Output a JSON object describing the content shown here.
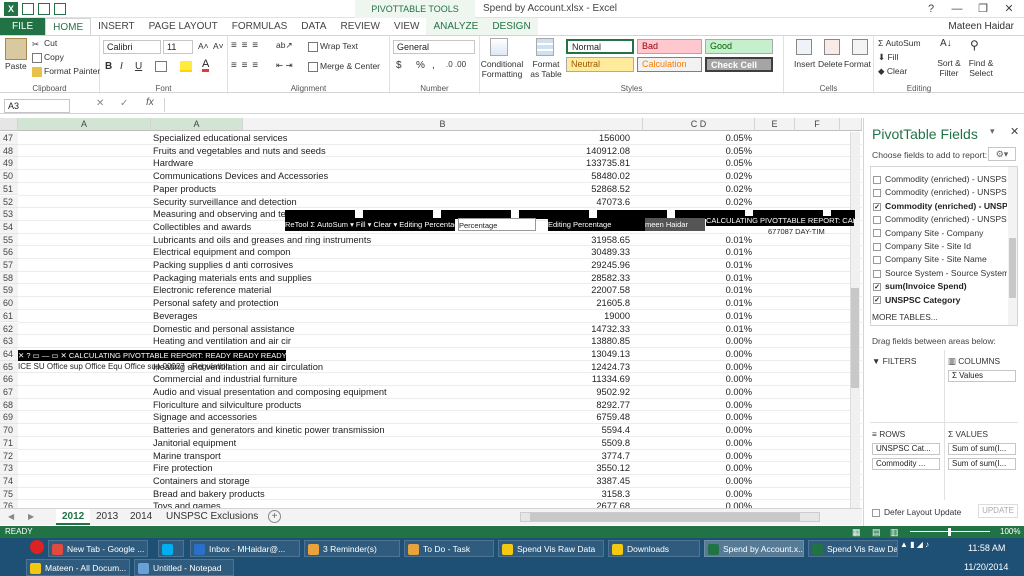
{
  "title_bar": {
    "context_tool": "PIVOTTABLE TOOLS",
    "document_title": "Spend by Account.xlsx - Excel",
    "help": "?",
    "minimize": "—",
    "restore": "❐",
    "close": "✕"
  },
  "tabs": [
    "FILE",
    "HOME",
    "INSERT",
    "PAGE LAYOUT",
    "FORMULAS",
    "DATA",
    "REVIEW",
    "VIEW",
    "ANALYZE",
    "DESIGN"
  ],
  "user": "Mateen Haidar",
  "ribbon": {
    "clipboard": {
      "label": "Clipboard",
      "paste": "Paste",
      "cut": "Cut",
      "copy": "Copy",
      "format_painter": "Format Painter"
    },
    "font": {
      "label": "Font",
      "name": "Calibri",
      "size": "11",
      "grow": "A˄",
      "shrink": "A˅",
      "bold": "B",
      "italic": "I",
      "underline": "U"
    },
    "alignment": {
      "label": "Alignment",
      "wrap": "Wrap Text",
      "merge": "Merge & Center"
    },
    "number": {
      "label": "Number",
      "format": "General",
      "currency": "$",
      "percent": "%",
      "comma": ","
    },
    "styles": {
      "label": "Styles",
      "conditional": "Conditional Formatting",
      "format_table": "Format as Table",
      "normal": "Normal",
      "bad": "Bad",
      "good": "Good",
      "neutral": "Neutral",
      "calculation": "Calculation",
      "check_cell": "Check Cell"
    },
    "cells": {
      "label": "Cells",
      "insert": "Insert",
      "delete": "Delete",
      "format": "Format"
    },
    "editing": {
      "label": "Editing",
      "autosum": "AutoSum",
      "fill": "Fill",
      "clear": "Clear",
      "sort": "Sort & Filter",
      "find": "Find & Select"
    }
  },
  "formula_bar": {
    "name_box": "A3",
    "fx": "fx"
  },
  "columns": [
    "A",
    "A",
    "B",
    "C D",
    "E",
    "F"
  ],
  "rows": [
    {
      "n": "47",
      "a": "Specialized educational services",
      "b": "156000",
      "d": "0.05%"
    },
    {
      "n": "48",
      "a": "Fruits and vegetables and nuts and seeds",
      "b": "140912.08",
      "d": "0.05%"
    },
    {
      "n": "49",
      "a": "Hardware",
      "b": "133735.81",
      "d": "0.05%"
    },
    {
      "n": "50",
      "a": "Communications Devices and Accessories",
      "b": "58480.02",
      "d": "0.02%"
    },
    {
      "n": "51",
      "a": "Paper products",
      "b": "52868.52",
      "d": "0.02%"
    },
    {
      "n": "52",
      "a": "Security surveillance and detection",
      "b": "47073.6",
      "d": "0.02%"
    },
    {
      "n": "53",
      "a": "Measuring and observing and testi",
      "b": "",
      "d": ""
    },
    {
      "n": "54",
      "a": "Collectibles and awards",
      "b": "",
      "d": ""
    },
    {
      "n": "55",
      "a": "Lubricants and oils and greases and ring instruments",
      "b": "31958.65",
      "d": "0.01%"
    },
    {
      "n": "56",
      "a": "Electrical equipment and compon",
      "b": "30489.33",
      "d": "0.01%"
    },
    {
      "n": "57",
      "a": "Packing supplies                 d anti corrosives",
      "b": "29245.96",
      "d": "0.01%"
    },
    {
      "n": "58",
      "a": "Packaging materials              ents and supplies",
      "b": "28582.33",
      "d": "0.01%"
    },
    {
      "n": "59",
      "a": "Electronic reference material",
      "b": "22007.58",
      "d": "0.01%"
    },
    {
      "n": "60",
      "a": "Personal safety and protection",
      "b": "21605.8",
      "d": "0.01%"
    },
    {
      "n": "61",
      "a": "Beverages",
      "b": "19000",
      "d": "0.01%"
    },
    {
      "n": "62",
      "a": "Domestic and personal assistance",
      "b": "14732.33",
      "d": "0.01%"
    },
    {
      "n": "63",
      "a": "Heating and ventilation and air cir",
      "b": "13880.85",
      "d": "0.00%"
    },
    {
      "n": "64",
      "a": "",
      "b": "13049.13",
      "d": "0.00%"
    },
    {
      "n": "65",
      "a": "Heating and ventilation and air circulation",
      "b": "12424.73",
      "d": "0.00%"
    },
    {
      "n": "66",
      "a": "Commercial and industrial furniture",
      "b": "11334.69",
      "d": "0.00%"
    },
    {
      "n": "67",
      "a": "Audio and visual presentation and composing equipment",
      "b": "9502.92",
      "d": "0.00%"
    },
    {
      "n": "68",
      "a": "Floriculture and silviculture products",
      "b": "8292.77",
      "d": "0.00%"
    },
    {
      "n": "69",
      "a": "Signage and accessories",
      "b": "6759.48",
      "d": "0.00%"
    },
    {
      "n": "70",
      "a": "Batteries and generators and kinetic power transmission",
      "b": "5594.4",
      "d": "0.00%"
    },
    {
      "n": "71",
      "a": "Janitorial equipment",
      "b": "5509.8",
      "d": "0.00%"
    },
    {
      "n": "72",
      "a": "Marine transport",
      "b": "3774.7",
      "d": "0.00%"
    },
    {
      "n": "73",
      "a": "Fire protection",
      "b": "3550.12",
      "d": "0.00%"
    },
    {
      "n": "74",
      "a": "Containers and storage",
      "b": "3387.45",
      "d": "0.00%"
    },
    {
      "n": "75",
      "a": "Bread and bakery products",
      "b": "3158.3",
      "d": "0.00%"
    },
    {
      "n": "76",
      "a": "Toys and games",
      "b": "2677.68",
      "d": "0.00%"
    }
  ],
  "overlays": {
    "a": "ReTool   Σ AutoSum   ▾   Fill ▾   Clear ▾   Editing  Percentage",
    "a2": "Editing  Percentage",
    "a3": "CALCULATING PIVOTTABLE REPORT: CALCU",
    "a4": "677087  DAY-TIM",
    "a5": "meen Haidar",
    "b": "✕  ?  ▭  —  ▭  ✕   CALCULATING PIVOTTABLE REPORT: READY READY READY",
    "c": "ICE SU Office sup Office Equ Office sup 00027 - Regulation"
  },
  "pivot": {
    "title": "PivotTable Fields",
    "subtitle": "Choose fields to add to report:",
    "fields": [
      {
        "name": "Commodity (enriched) - UNSPSC",
        "checked": false
      },
      {
        "name": "Commodity (enriched) - UNSPSC...",
        "checked": false
      },
      {
        "name": "Commodity (enriched) - UNSP...",
        "checked": true
      },
      {
        "name": "Commodity (enriched) - UNSPSC...",
        "checked": false
      },
      {
        "name": "Company Site - Company",
        "checked": false
      },
      {
        "name": "Company Site - Site Id",
        "checked": false
      },
      {
        "name": "Company Site - Site Name",
        "checked": false
      },
      {
        "name": "Source System - Source System",
        "checked": false
      },
      {
        "name": "sum(Invoice Spend)",
        "checked": true
      },
      {
        "name": "UNSPSC Category",
        "checked": true
      }
    ],
    "more": "MORE TABLES...",
    "drag_hint": "Drag fields between areas below:",
    "filters": "FILTERS",
    "columns": "COLUMNS",
    "columns_chip": "Σ Values",
    "rows": "ROWS",
    "values": "VALUES",
    "row_chips": [
      "UNSPSC Cat...",
      "Commodity ..."
    ],
    "value_chips": [
      "Sum of sum(I...",
      "Sum of sum(I..."
    ],
    "defer": "Defer Layout Update",
    "update": "UPDATE"
  },
  "sheets": [
    "2012",
    "2013",
    "2014",
    "UNSPSC Exclusions"
  ],
  "status": {
    "ready": "READY",
    "zoom": "100%"
  },
  "taskbar": {
    "items": [
      {
        "label": "New Tab - Google ...",
        "color": "#e04a3f"
      },
      {
        "label": "",
        "color": "#00aff0"
      },
      {
        "label": "Inbox - MHaidar@...",
        "color": "#2a6fc9"
      },
      {
        "label": "3 Reminder(s)",
        "color": "#e8a33d"
      },
      {
        "label": "To Do - Task",
        "color": "#e8a33d"
      },
      {
        "label": "Spend Vis Raw Data",
        "color": "#f2c811"
      },
      {
        "label": "Downloads",
        "color": "#f2c811"
      },
      {
        "label": "Spend by Account.x...",
        "color": "#217346"
      },
      {
        "label": "Spend Vis Raw Dat...",
        "color": "#217346"
      },
      {
        "label": "Mateen - All Docum...",
        "color": "#f2c811"
      },
      {
        "label": "Untitled - Notepad",
        "color": "#6aa0d8"
      }
    ],
    "time": "11:58 AM",
    "date": "11/20/2014"
  }
}
